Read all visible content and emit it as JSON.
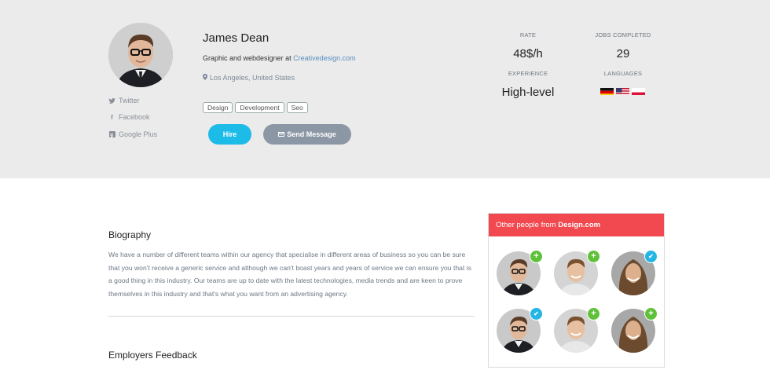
{
  "profile": {
    "name": "James Dean",
    "role_prefix": "Graphic and webdesigner at ",
    "company": "Creativedesign.com",
    "location": "Los Angeles, United States",
    "tags": [
      "Design",
      "Development",
      "Seo"
    ],
    "hire_label": "Hire",
    "message_label": "Send Message"
  },
  "social": {
    "twitter": "Twitter",
    "facebook": "Facebook",
    "google": "Google Plus"
  },
  "stats": {
    "rate_label": "RATE",
    "rate_value": "48$/h",
    "jobs_label": "JOBS COMPLETED",
    "jobs_value": "29",
    "experience_label": "EXPERIENCE",
    "experience_value": "High-level",
    "languages_label": "LANGUAGES",
    "languages": [
      "german-flag",
      "us-flag",
      "polish-flag"
    ]
  },
  "biography": {
    "title": "Biography",
    "text": "We have a number of different teams within our agency that specialise in different areas of business so you can be sure that you won't receive a generic service and although we can't boast years and years of service we can ensure you that is a good thing in this industry. Our teams are up to date with the latest technologies, media trends and are keen to prove themselves in this industry and that's what you want from an advertising agency."
  },
  "feedback": {
    "title": "Employers Feedback"
  },
  "others": {
    "title_prefix": "Other people from ",
    "title_company": "Design.com",
    "people": [
      {
        "badge": "add",
        "icon": "plus-icon"
      },
      {
        "badge": "add",
        "icon": "plus-icon"
      },
      {
        "badge": "ok",
        "icon": "check-icon"
      },
      {
        "badge": "ok",
        "icon": "check-icon"
      },
      {
        "badge": "add",
        "icon": "plus-icon"
      },
      {
        "badge": "add",
        "icon": "plus-icon"
      }
    ]
  },
  "colors": {
    "accent_blue": "#1cbbe8",
    "panel_red": "#f1494f",
    "badge_green": "#5fc13a"
  }
}
